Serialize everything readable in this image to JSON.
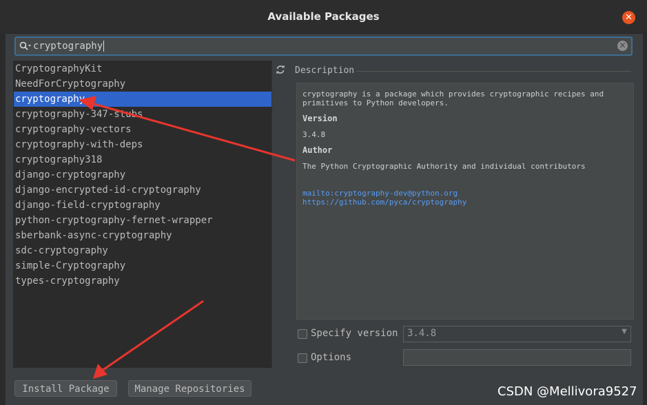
{
  "dialog": {
    "title": "Available Packages"
  },
  "search": {
    "value": "cryptography"
  },
  "packages": [
    "CryptographyKit",
    "NeedForCryptography",
    "cryptography",
    "cryptography-347-stubs",
    "cryptography-vectors",
    "cryptography-with-deps",
    "cryptography318",
    "django-cryptography",
    "django-encrypted-id-cryptography",
    "django-field-cryptography",
    "python-cryptography-fernet-wrapper",
    "sberbank-async-cryptography",
    "sdc-cryptography",
    "simple-Cryptography",
    "types-cryptography"
  ],
  "selected_package": "cryptography",
  "description": {
    "label": "Description",
    "text": "cryptography is a package which provides cryptographic recipes and primitives to Python developers.",
    "version_heading": "Version",
    "version": "3.4.8",
    "author_heading": "Author",
    "author": "The Python Cryptographic Authority and individual contributors",
    "mailto": "mailto:cryptography-dev@python.org",
    "url": "https://github.com/pyca/cryptography"
  },
  "specify_version": {
    "label": "Specify version",
    "value": "3.4.8",
    "checked": false
  },
  "options": {
    "label": "Options",
    "checked": false,
    "value": ""
  },
  "buttons": {
    "install": "Install Package",
    "manage": "Manage Repositories"
  },
  "watermark": "CSDN @Mellivora9527",
  "colors": {
    "selection": "#2f65ca",
    "annotation_arrow": "#e8352d",
    "close": "#e95420",
    "link": "#589df6"
  }
}
